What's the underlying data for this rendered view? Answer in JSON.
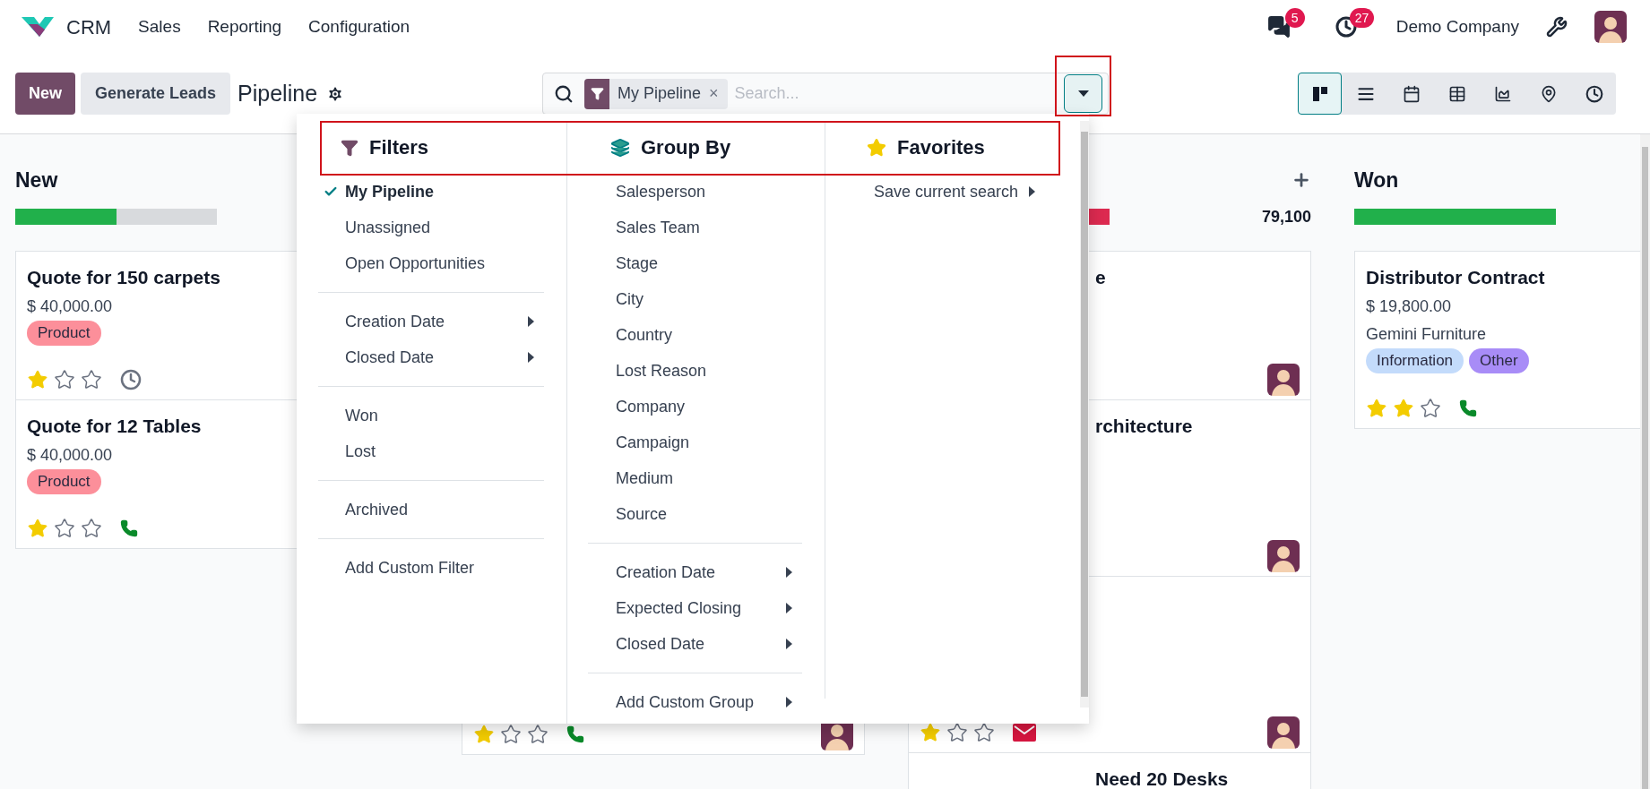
{
  "app": {
    "name": "CRM",
    "menu": [
      "Sales",
      "Reporting",
      "Configuration"
    ]
  },
  "systray": {
    "messages_count": "5",
    "activities_count": "27",
    "company": "Demo Company"
  },
  "control_panel": {
    "new_button": "New",
    "generate_button": "Generate Leads",
    "title": "Pipeline",
    "search": {
      "facets": [
        {
          "label": "My Pipeline",
          "remove": "×"
        }
      ],
      "placeholder": "Search..."
    },
    "views": [
      {
        "kind": "kanban",
        "selected": true
      },
      {
        "kind": "list",
        "selected": false
      },
      {
        "kind": "calendar",
        "selected": false
      },
      {
        "kind": "pivot",
        "selected": false
      },
      {
        "kind": "graph",
        "selected": false
      },
      {
        "kind": "map",
        "selected": false
      },
      {
        "kind": "activity",
        "selected": false
      }
    ]
  },
  "search_panel": {
    "filters": {
      "title": "Filters",
      "groups": [
        [
          {
            "label": "My Pipeline",
            "checked": true,
            "submenu": false
          },
          {
            "label": "Unassigned",
            "checked": false,
            "submenu": false
          },
          {
            "label": "Open Opportunities",
            "checked": false,
            "submenu": false
          }
        ],
        [
          {
            "label": "Creation Date",
            "checked": false,
            "submenu": true
          },
          {
            "label": "Closed Date",
            "checked": false,
            "submenu": true
          }
        ],
        [
          {
            "label": "Won",
            "checked": false,
            "submenu": false
          },
          {
            "label": "Lost",
            "checked": false,
            "submenu": false
          }
        ],
        [
          {
            "label": "Archived",
            "checked": false,
            "submenu": false
          }
        ],
        [
          {
            "label": "Add Custom Filter",
            "checked": false,
            "submenu": false
          }
        ]
      ]
    },
    "group_by": {
      "title": "Group By",
      "groups": [
        [
          {
            "label": "Salesperson",
            "submenu": false
          },
          {
            "label": "Sales Team",
            "submenu": false
          },
          {
            "label": "Stage",
            "submenu": false
          },
          {
            "label": "City",
            "submenu": false
          },
          {
            "label": "Country",
            "submenu": false
          },
          {
            "label": "Lost Reason",
            "submenu": false
          },
          {
            "label": "Company",
            "submenu": false
          },
          {
            "label": "Campaign",
            "submenu": false
          },
          {
            "label": "Medium",
            "submenu": false
          },
          {
            "label": "Source",
            "submenu": false
          }
        ],
        [
          {
            "label": "Creation Date",
            "submenu": true
          },
          {
            "label": "Expected Closing",
            "submenu": true
          },
          {
            "label": "Closed Date",
            "submenu": true
          }
        ],
        [
          {
            "label": "Add Custom Group",
            "submenu": true
          }
        ]
      ]
    },
    "favorites": {
      "title": "Favorites",
      "items": [
        {
          "label": "Save current search",
          "submenu": true
        }
      ]
    }
  },
  "kanban": {
    "columns": [
      {
        "title": "New",
        "progress": [
          {
            "color": "#21b04b",
            "level": 0.5
          }
        ],
        "cards": [
          {
            "title": "Quote for 150 carpets",
            "amount": "$ 40,000.00",
            "tags": [
              {
                "label": "Product",
                "color": "#fc8f9a"
              }
            ],
            "stars": 1,
            "activity": {
              "kind": "clock"
            }
          },
          {
            "title": "Quote for 12 Tables",
            "amount": "$ 40,000.00",
            "tags": [
              {
                "label": "Product",
                "color": "#fc8f9a"
              }
            ],
            "stars": 1,
            "activity": {
              "kind": "phone"
            }
          }
        ]
      },
      {
        "cards": [
          {
            "stars": 1,
            "activity": {
              "kind": "phone"
            },
            "avatar": true
          }
        ]
      },
      {
        "add_icon": true,
        "total": "79,100",
        "progress": [
          {
            "color": "#dc2a50",
            "level": 1
          }
        ],
        "cards": [
          {
            "title": "e",
            "avatar": true
          },
          {
            "title": "rchitecture",
            "avatar": true
          },
          {
            "stars": 1,
            "activity": {
              "kind": "mail"
            },
            "avatar": true
          },
          {
            "title": "Need 20 Desks"
          }
        ]
      },
      {
        "title": "Won",
        "progress": [
          {
            "color": "#21b04b",
            "level": 1
          }
        ],
        "cards": [
          {
            "title": "Distributor Contract",
            "amount": "$ 19,800.00",
            "partner": "Gemini Furniture",
            "tags": [
              {
                "label": "Information",
                "color": "#c3dbfb"
              },
              {
                "label": "Other",
                "color": "#a88cf7"
              }
            ],
            "stars": 2,
            "activity": {
              "kind": "phone"
            }
          }
        ]
      }
    ]
  }
}
